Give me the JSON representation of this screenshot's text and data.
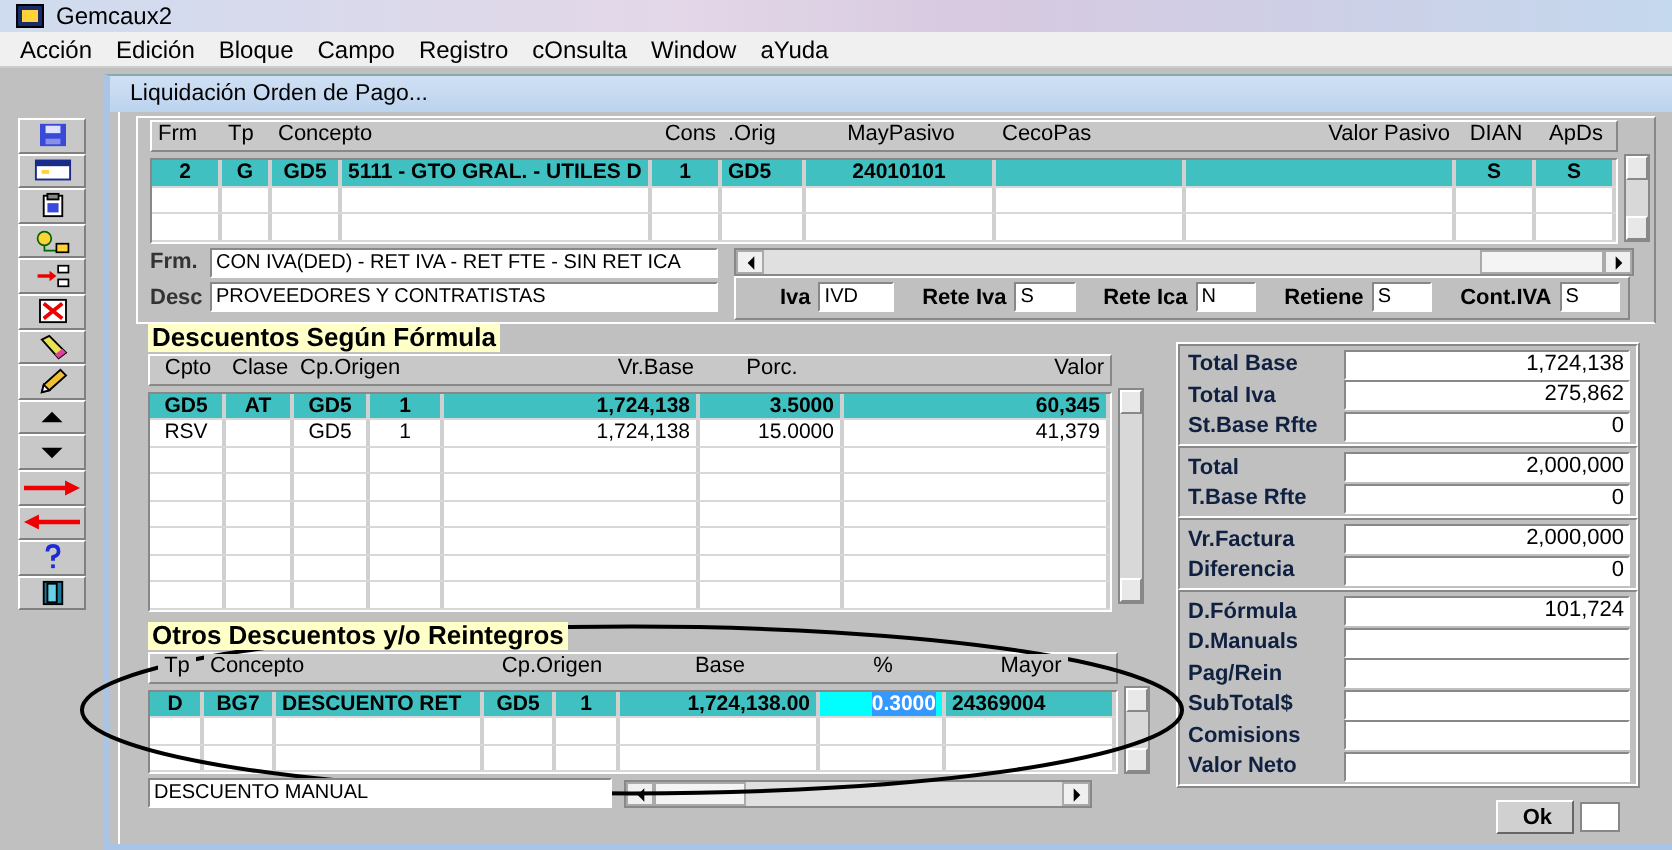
{
  "window": {
    "title": "Gemcaux2"
  },
  "menu": [
    "Acción",
    "Edición",
    "Bloque",
    "Campo",
    "Registro",
    "cOnsulta",
    "Window",
    "aYuda"
  ],
  "form": {
    "title": "Liquidación Orden de Pago..."
  },
  "orders": {
    "columns": [
      "Frm",
      "Tp",
      "Concepto",
      "Cons",
      ".Orig",
      "MayPasivo",
      "CecoPas",
      "Valor Pasivo",
      "DIAN",
      "ApDs"
    ],
    "rows": [
      {
        "frm": "2",
        "tp": "G",
        "code": "GD5",
        "concepto": "5111 - GTO GRAL. - UTILES D",
        "cons": "1",
        "orig": "GD5",
        "may_pasivo": "24010101",
        "dian": "S",
        "apds": "S",
        "selected": true
      }
    ]
  },
  "frm": {
    "label": "Frm.",
    "value": "CON IVA(DED) - RET IVA - RET FTE - SIN RET ICA"
  },
  "desc": {
    "label": "Desc",
    "value": "PROVEEDORES Y CONTRATISTAS"
  },
  "flags": [
    {
      "label": "Iva",
      "value": "IVD"
    },
    {
      "label": "Rete Iva",
      "value": "S"
    },
    {
      "label": "Rete Ica",
      "value": "N"
    },
    {
      "label": "Retiene",
      "value": "S"
    },
    {
      "label": "Cont.IVA",
      "value": "S"
    }
  ],
  "formula": {
    "heading": "Descuentos Según Fórmula",
    "columns": [
      "Cpto",
      "Clase",
      "Cp.Origen",
      "Vr.Base",
      "Porc.",
      "Valor"
    ],
    "rows": [
      {
        "cpto": "GD5",
        "clase": "AT",
        "cp_origen": "GD5",
        "cp_num": "1",
        "vr_base": "1,724,138",
        "porc": "3.5000",
        "valor": "60,345",
        "selected": true
      },
      {
        "cpto": "RSV",
        "cp_origen": "GD5",
        "cp_num": "1",
        "vr_base": "1,724,138",
        "porc": "15.0000",
        "valor": "41,379",
        "selected": false
      }
    ]
  },
  "otros": {
    "heading": "Otros Descuentos y/o Reintegros",
    "columns": [
      "Tp",
      "Concepto",
      "Cp.Origen",
      "Base",
      "%",
      "Mayor"
    ],
    "rows": [
      {
        "tp": "D",
        "code": "BG7",
        "concepto": "DESCUENTO RET",
        "cp_origen": "GD5",
        "cp_num": "1",
        "base": "1,724,138.00",
        "pct": "0.3000",
        "mayor": "24369004",
        "selected": true,
        "pct_selected": true
      }
    ],
    "footer": "DESCUENTO MANUAL"
  },
  "totals": [
    [
      {
        "label": "Total Base",
        "value": "1,724,138"
      },
      {
        "label": "Total Iva",
        "value": "275,862"
      },
      {
        "label": "St.Base Rfte",
        "value": "0"
      }
    ],
    [
      {
        "label": "Total",
        "value": "2,000,000"
      },
      {
        "label": "T.Base Rfte",
        "value": "0"
      }
    ],
    [
      {
        "label": "Vr.Factura",
        "value": "2,000,000"
      },
      {
        "label": "Diferencia",
        "value": "0"
      }
    ],
    [
      {
        "label": "D.Fórmula",
        "value": "101,724"
      },
      {
        "label": "D.Manuals"
      },
      {
        "label": "Pag/Rein"
      },
      {
        "label": "SubTotal$"
      },
      {
        "label": "Comisions"
      },
      {
        "label": "Valor Neto"
      }
    ]
  ],
  "ok": "Ok"
}
